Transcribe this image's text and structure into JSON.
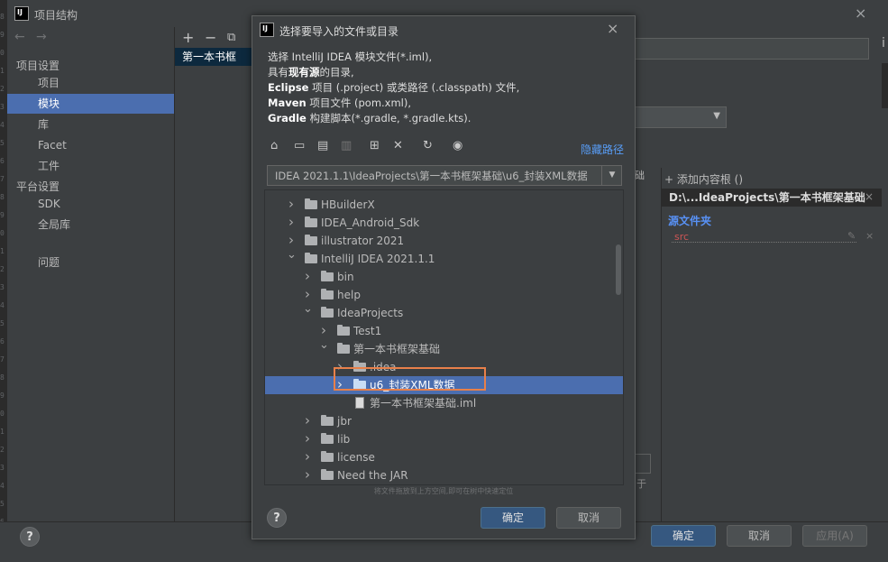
{
  "window": {
    "title": "项目结构",
    "close_symbol": "×"
  },
  "gutter_numbers": [
    "8",
    "9",
    "0",
    "1",
    "2",
    "3",
    "4",
    "5",
    "6",
    "7",
    "8",
    "9",
    "0",
    "1",
    "2",
    "3",
    "4",
    "5",
    "6",
    "7",
    "8",
    "9",
    "0",
    "1",
    "2",
    "3",
    "4",
    "5",
    "6",
    "7"
  ],
  "nav": {
    "back_symbol": "←",
    "forward_symbol": "→",
    "project_settings_header": "项目设置",
    "items": [
      {
        "label": "项目",
        "selected": false
      },
      {
        "label": "模块",
        "selected": true
      },
      {
        "label": "库",
        "selected": false
      },
      {
        "label": "Facet",
        "selected": false
      },
      {
        "label": "工件",
        "selected": false
      }
    ],
    "platform_settings_header": "平台设置",
    "platform_items": [
      {
        "label": "SDK"
      },
      {
        "label": "全局库"
      }
    ],
    "problems_label": "问题"
  },
  "module_panel": {
    "add_symbol": "+",
    "remove_symbol": "−",
    "copy_symbol": "⧉",
    "item_label": "第一本书框"
  },
  "right_panel": {
    "fragment_label": "础",
    "add_content_root": "+ 添加内容根 ()",
    "content_root_path": "D:\\...IdeaProjects\\第一本书框架基础",
    "source_folders_title": "源文件夹",
    "source_folder": "src",
    "partial_char": "于",
    "edge_char": "i"
  },
  "bottom": {
    "help": "?",
    "ok": "确定",
    "cancel": "取消",
    "apply": "应用(A)"
  },
  "dialog": {
    "title": "选择要导入的文件或目录",
    "close_symbol": "×",
    "description": {
      "line1": "选择 IntelliJ IDEA 模块文件(*.iml),",
      "line2_pre": "具有",
      "line2_bold": "现有源",
      "line2_post": "的目录,",
      "line3_bold": "Eclipse",
      "line3_rest": " 项目 (.project) 或类路径 (.classpath) 文件,",
      "line4_bold": "Maven",
      "line4_rest": " 项目文件 (pom.xml),",
      "line5_bold": "Gradle",
      "line5_rest": " 构建脚本(*.gradle, *.gradle.kts)."
    },
    "toolbar": {
      "hide_path": "隐藏路径"
    },
    "path": "IDEA 2021.1.1\\IdeaProjects\\第一本书框架基础\\u6_封装XML数据",
    "tree": [
      {
        "label": "HBuilderX",
        "depth": 0,
        "expanded": false,
        "type": "folder",
        "selected": false
      },
      {
        "label": "IDEA_Android_Sdk",
        "depth": 0,
        "expanded": false,
        "type": "folder",
        "selected": false
      },
      {
        "label": "illustrator 2021",
        "depth": 0,
        "expanded": false,
        "type": "folder",
        "selected": false
      },
      {
        "label": "IntelliJ IDEA 2021.1.1",
        "depth": 0,
        "expanded": true,
        "type": "folder",
        "selected": false
      },
      {
        "label": "bin",
        "depth": 1,
        "expanded": false,
        "type": "folder",
        "selected": false
      },
      {
        "label": "help",
        "depth": 1,
        "expanded": false,
        "type": "folder",
        "selected": false
      },
      {
        "label": "IdeaProjects",
        "depth": 1,
        "expanded": true,
        "type": "folder",
        "selected": false
      },
      {
        "label": "Test1",
        "depth": 2,
        "expanded": false,
        "type": "folder",
        "selected": false
      },
      {
        "label": "第一本书框架基础",
        "depth": 2,
        "expanded": true,
        "type": "folder",
        "selected": false
      },
      {
        "label": ".idea",
        "depth": 3,
        "expanded": false,
        "type": "folder",
        "selected": false
      },
      {
        "label": "u6_封装XML数据",
        "depth": 3,
        "expanded": false,
        "type": "folder",
        "selected": true
      },
      {
        "label": "第一本书框架基础.iml",
        "depth": 3,
        "expanded": null,
        "type": "file",
        "selected": false
      },
      {
        "label": "jbr",
        "depth": 1,
        "expanded": false,
        "type": "folder",
        "selected": false
      },
      {
        "label": "lib",
        "depth": 1,
        "expanded": false,
        "type": "folder",
        "selected": false
      },
      {
        "label": "license",
        "depth": 1,
        "expanded": false,
        "type": "folder",
        "selected": false
      },
      {
        "label": "Need the JAR",
        "depth": 1,
        "expanded": false,
        "type": "folder",
        "selected": false
      }
    ],
    "hint": "将文件拖放到上方空间,即可在树中快速定位",
    "help": "?",
    "ok": "确定",
    "cancel": "取消"
  },
  "colors": {
    "background": "#3c3f41",
    "selection": "#4b6eaf",
    "primary_button": "#365880",
    "link": "#589df6",
    "highlight_box": "#e8804a",
    "source_folder": "#cc5555"
  }
}
